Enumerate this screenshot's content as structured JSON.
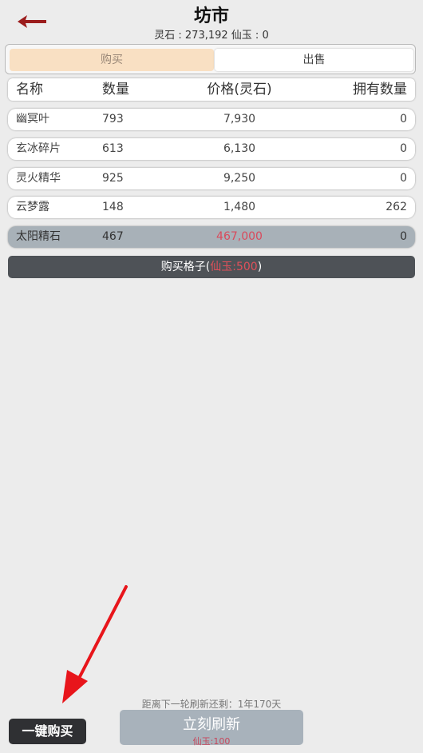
{
  "header": {
    "title": "坊市",
    "currency_text": "灵石 : 273,192  仙玉 : 0"
  },
  "tabs": {
    "buy_label": "购买",
    "sell_label": "出售"
  },
  "table": {
    "columns": {
      "name": "名称",
      "qty": "数量",
      "price": "价格(灵石)",
      "owned": "拥有数量"
    },
    "rows": [
      {
        "name": "幽冥叶",
        "qty": "793",
        "price": "7,930",
        "owned": "0"
      },
      {
        "name": "玄冰碎片",
        "qty": "613",
        "price": "6,130",
        "owned": "0"
      },
      {
        "name": "灵火精华",
        "qty": "925",
        "price": "9,250",
        "owned": "0"
      },
      {
        "name": "云梦露",
        "qty": "148",
        "price": "1,480",
        "owned": "262"
      },
      {
        "name": "太阳精石",
        "qty": "467",
        "price": "467,000",
        "owned": "0"
      }
    ]
  },
  "buy_slot": {
    "prefix": "购买格子(",
    "cost": "仙玉:500",
    "suffix": ")"
  },
  "refresh": {
    "timer_text": "距离下一轮刷新还剩：1年170天",
    "button_label": "立刻刷新",
    "cost": "仙玉:100"
  },
  "one_click_buy_label": "一键购买",
  "colors": {
    "accent_red": "#d94a5c",
    "tab_active": "#f9e0c3",
    "dark_button": "#2f3033"
  }
}
